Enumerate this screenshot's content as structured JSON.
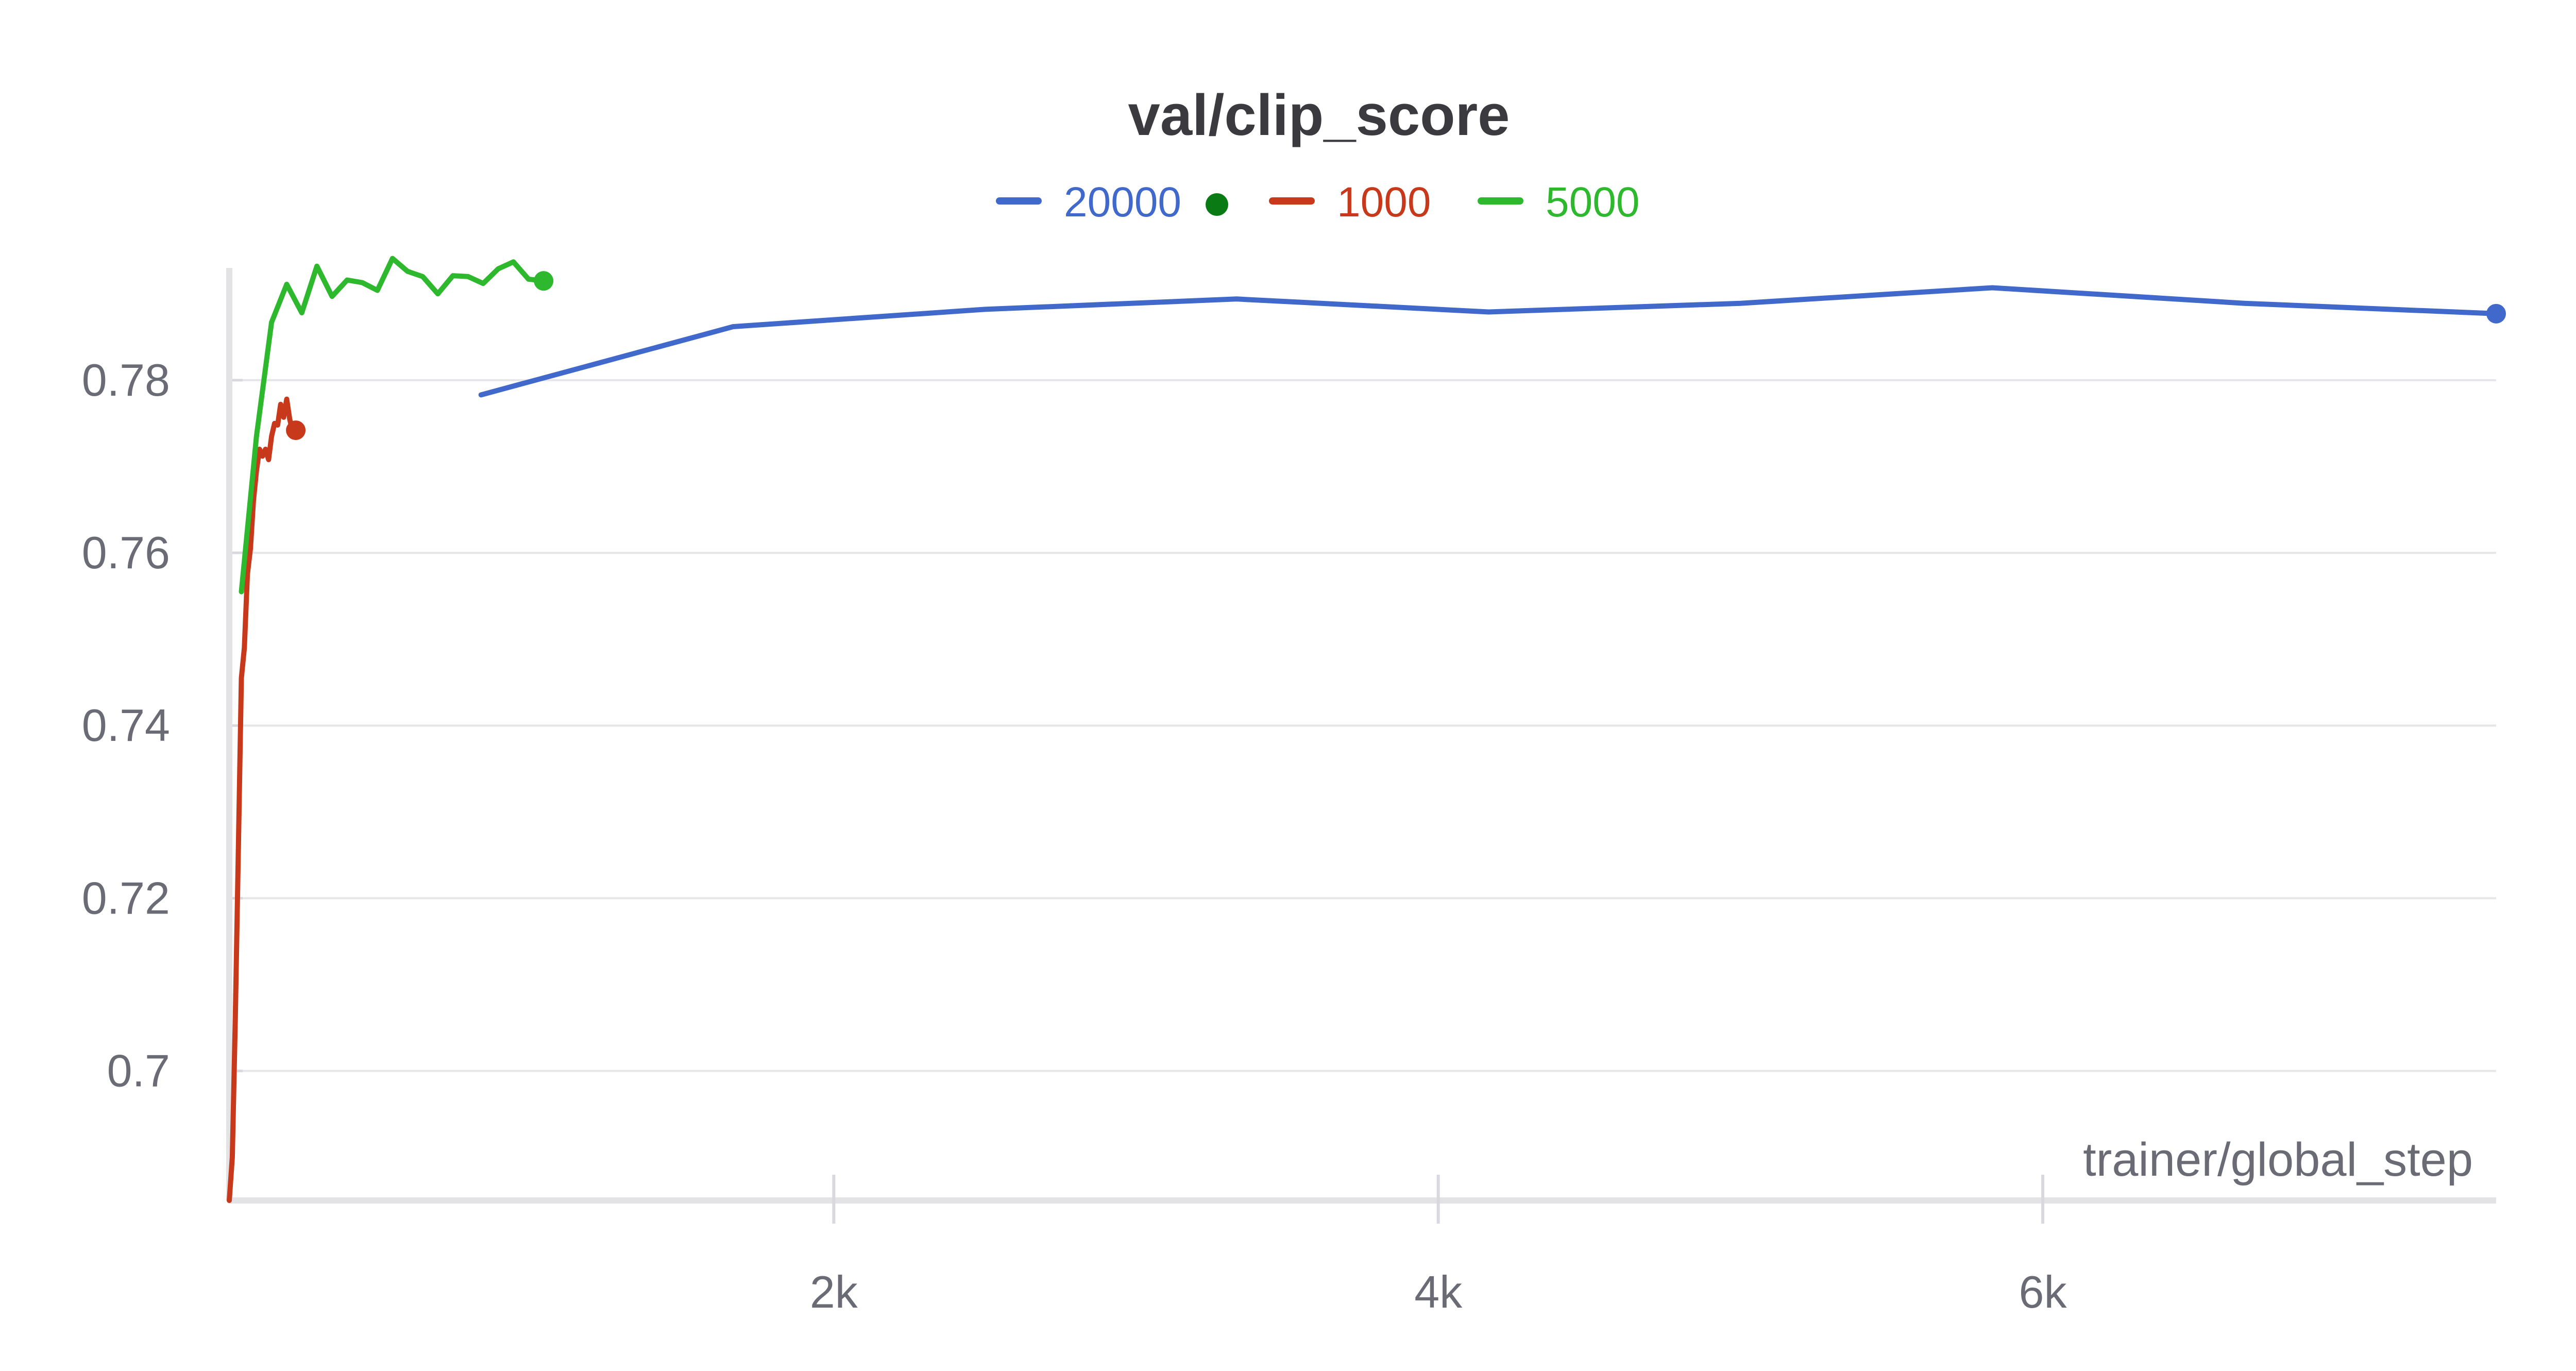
{
  "chart_data": {
    "type": "line",
    "title": "val/clip_score",
    "xlabel": "trainer/global_step",
    "ylabel": "",
    "xlim": [
      0,
      7500
    ],
    "ylim": [
      0.685,
      0.793
    ],
    "x_ticks": [
      {
        "value": 2000,
        "label": "2k"
      },
      {
        "value": 4000,
        "label": "4k"
      },
      {
        "value": 6000,
        "label": "6k"
      }
    ],
    "y_ticks": [
      {
        "value": 0.7,
        "label": "0.7"
      },
      {
        "value": 0.72,
        "label": "0.72"
      },
      {
        "value": 0.74,
        "label": "0.74"
      },
      {
        "value": 0.76,
        "label": "0.76"
      },
      {
        "value": 0.78,
        "label": "0.78"
      }
    ],
    "grid": true,
    "legend_position": "top-center",
    "legend_marker": {
      "color": "#0a7a14"
    },
    "series": [
      {
        "name": "20000",
        "color": "#4169cc",
        "end_marker": true,
        "x": [
          833,
          1667,
          2500,
          3333,
          4167,
          5000,
          5833,
          6667,
          7500
        ],
        "y": [
          0.7783,
          0.7862,
          0.7882,
          0.7894,
          0.7879,
          0.7889,
          0.7907,
          0.7889,
          0.7877
        ]
      },
      {
        "name": "1000",
        "color": "#c8391b",
        "end_marker": true,
        "x": [
          0,
          10,
          20,
          30,
          40,
          50,
          60,
          70,
          80,
          90,
          100,
          110,
          120,
          130,
          140,
          150,
          160,
          170,
          180,
          190,
          200,
          210,
          220
        ],
        "y": [
          0.685,
          0.69,
          0.706,
          0.7255,
          0.7455,
          0.749,
          0.7575,
          0.7605,
          0.766,
          0.7695,
          0.772,
          0.7712,
          0.772,
          0.7708,
          0.7735,
          0.775,
          0.7748,
          0.7772,
          0.7757,
          0.7778,
          0.7755,
          0.774,
          0.7742
        ]
      },
      {
        "name": "5000",
        "color": "#2eb82e",
        "end_marker": true,
        "x": [
          40,
          90,
          140,
          190,
          240,
          290,
          340,
          390,
          440,
          490,
          540,
          590,
          640,
          690,
          740,
          790,
          840,
          890,
          940,
          990,
          1040
        ],
        "y": [
          0.7555,
          0.7735,
          0.7867,
          0.7911,
          0.7878,
          0.7932,
          0.7897,
          0.7916,
          0.7913,
          0.7904,
          0.7941,
          0.7926,
          0.792,
          0.79,
          0.7921,
          0.792,
          0.7912,
          0.7929,
          0.7937,
          0.7917,
          0.7915
        ]
      }
    ]
  }
}
